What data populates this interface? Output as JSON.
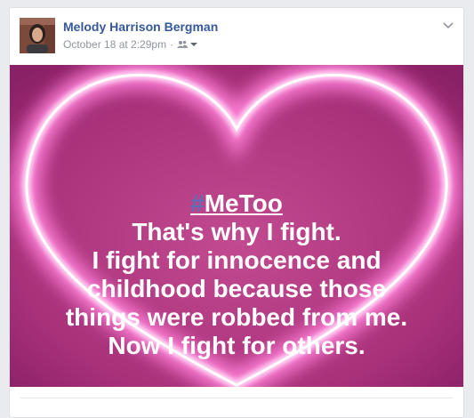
{
  "post": {
    "author": "Melody Harrison Bergman",
    "timestamp": "October 18 at 2:29pm",
    "separator": "·",
    "audience_icon": "friends-icon",
    "menu_icon": "chevron-down-icon"
  },
  "image": {
    "hashtag_symbol": "#",
    "hashtag_word": "MeToo",
    "lines": [
      "That's why I fight.",
      "I fight for innocence and",
      "childhood because those",
      "things were robbed from me.",
      "Now I fight for others."
    ]
  },
  "colors": {
    "author_link": "#365899",
    "meta_text": "#90949c",
    "image_background": "#b23a7e",
    "neon_glow": "#ff9ee6",
    "hashtag": "#5b6fb8"
  }
}
